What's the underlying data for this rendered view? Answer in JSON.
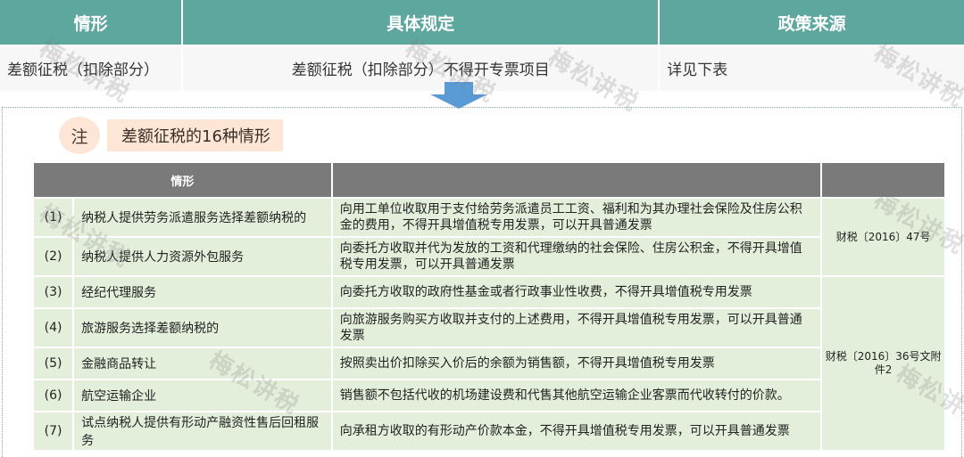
{
  "top": {
    "headers": [
      "情形",
      "具体规定",
      "政策来源"
    ],
    "row": [
      "差额征税（扣除部分）",
      "差额征税（扣除部分）不得开专票项目",
      "详见下表"
    ]
  },
  "note": {
    "marker": "注",
    "title": "差额征税的16种情形"
  },
  "table": {
    "headers": [
      "情形",
      "",
      ""
    ],
    "rows": [
      {
        "num": "(1)",
        "case": "纳税人提供劳务派遣服务选择差额纳税的",
        "rule": "向用工单位收取用于支付给劳务派遣员工工资、福利和为其办理社会保险及住房公积金的费用，不得开具增值税专用发票，可以开具普通发票"
      },
      {
        "num": "(2)",
        "case": "纳税人提供人力资源外包服务",
        "rule": "向委托方收取并代为发放的工资和代理缴纳的社会保险、住房公积金，不得开具增值税专用发票，可以开具普通发票"
      },
      {
        "num": "(3)",
        "case": "经纪代理服务",
        "rule": "向委托方收取的政府性基金或者行政事业性收费，不得开具增值税专用发票"
      },
      {
        "num": "(4)",
        "case": "旅游服务选择差额纳税的",
        "rule": "向旅游服务购买方收取并支付的上述费用，不得开具增值税专用发票，可以开具普通发票"
      },
      {
        "num": "(5)",
        "case": "金融商品转让",
        "rule": "按照卖出价扣除买入价后的余额为销售额，不得开具增值税专用发票"
      },
      {
        "num": "(6)",
        "case": "航空运输企业",
        "rule": "销售额不包括代收的机场建设费和代售其他航空运输企业客票而代收转付的价款。"
      },
      {
        "num": "(7)",
        "case": "试点纳税人提供有形动产融资性售后回租服务",
        "rule": "向承租方收取的有形动产价款本金，不得开具增值税专用发票，可以开具普通发票"
      }
    ],
    "sources": {
      "s1": "财税〔2016〕47号",
      "s2": "财税〔2016〕36号文附件2"
    }
  },
  "watermark": "梅松讲税",
  "colors": {
    "header_teal": "#5ea79e",
    "row_green": "#e3efda",
    "header_gray": "#7a7a7a",
    "note_peach": "#fde6d5",
    "arrow_blue": "#5b9bd5"
  }
}
